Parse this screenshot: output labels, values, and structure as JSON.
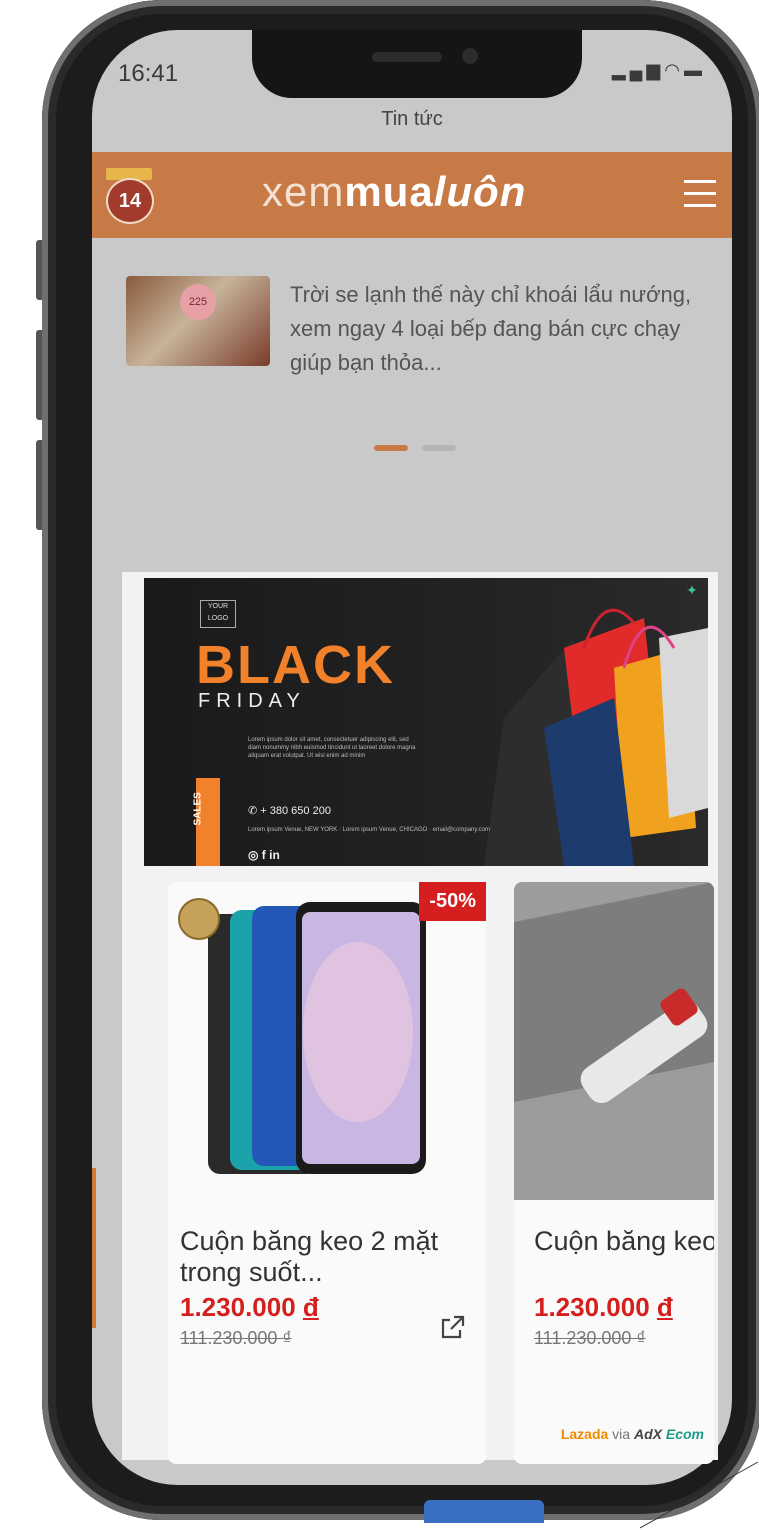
{
  "status_bar": {
    "time": "16:41",
    "icons": "signal-wifi-battery"
  },
  "site_title": "Tin tức",
  "header": {
    "logo_text": "14",
    "brand_prefix": "xem",
    "brand_bold": "mua",
    "brand_italic": "luôn",
    "menu_icon": "hamburger-icon",
    "color": "#c77a46"
  },
  "news": {
    "thumb_badge": "225",
    "title": "Trời se lạnh thế này chỉ khoái lẩu nướng, xem ngay 4 loại bếp đang bán cực chạy giúp bạn thỏa..."
  },
  "carousel": {
    "active_index": 0,
    "count": 2,
    "active_color": "#c77a46",
    "inactive_color": "#b5b5b5"
  },
  "banner": {
    "your_logo": "YOUR LOGO",
    "headline": "BLACK",
    "subheadline": "FRIDAY",
    "sales_tag": "SALES",
    "lorem": "Lorem ipsum dolor sit amet, consectetuer adipiscing elit, sed diam nonummy nibh euismod tincidunt ut laoreet dolore magna aliquam erat volutpat. Ut wisi enim ad minim",
    "phone": "+ 380 650 200",
    "address": "Lorem ipsum Venue, NEW YORK · Lorem ipsum Venue, CHICAGO · email@company.com",
    "social": "◎ f in"
  },
  "products": [
    {
      "title": "Cuộn băng keo 2 mặt trong suốt...",
      "price": "1.230.000",
      "currency": "đ",
      "old_price": "111.230.000 ₫",
      "discount": "-50%"
    },
    {
      "title": "Cuộn băng keo acrylic trong suốt",
      "price": "1.230.000",
      "currency": "đ",
      "old_price": "111.230.000 ₫"
    }
  ],
  "ad_footer": {
    "lazada": "Lazada",
    "via": " via ",
    "adx": "AdX",
    "ecom": "Ecom"
  }
}
